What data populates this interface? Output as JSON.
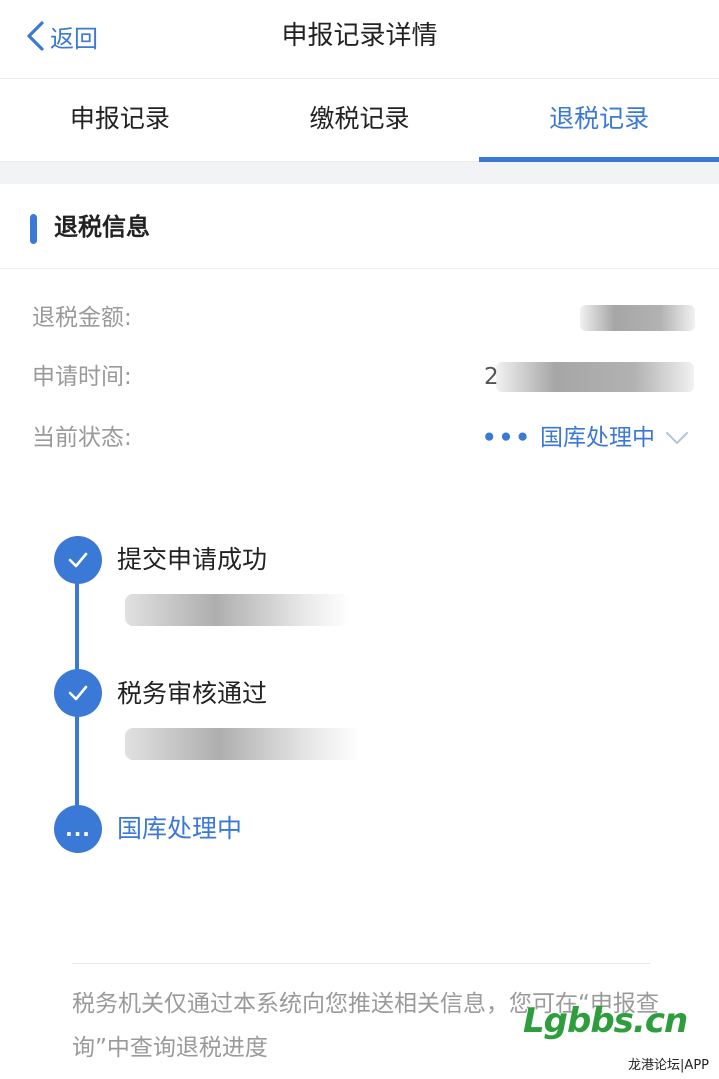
{
  "nav": {
    "back_label": "返回",
    "title": "申报记录详情"
  },
  "tabs": [
    {
      "label": "申报记录",
      "active": false
    },
    {
      "label": "缴税记录",
      "active": false
    },
    {
      "label": "退税记录",
      "active": true
    }
  ],
  "section": {
    "title": "退税信息"
  },
  "info": {
    "refund_amount_label": "退税金额:",
    "apply_time_label": "申请时间:",
    "apply_time_prefix": "2",
    "status_label": "当前状态:",
    "status_value": "国库处理中",
    "status_dots": "•••"
  },
  "timeline": [
    {
      "title": "提交申请成功",
      "done": true
    },
    {
      "title": "税务审核通过",
      "done": true
    },
    {
      "title": "国库处理中",
      "done": false,
      "node_text": "..."
    }
  ],
  "note": "税务机关仅通过本系统向您推送相关信息，您可在“申报查询”中查询退税进度",
  "watermark": {
    "logo": "Lgbbs.cn",
    "sub": "龙港论坛|APP"
  },
  "colors": {
    "accent": "#3b79d6",
    "label_gray": "#9a9a9a"
  }
}
